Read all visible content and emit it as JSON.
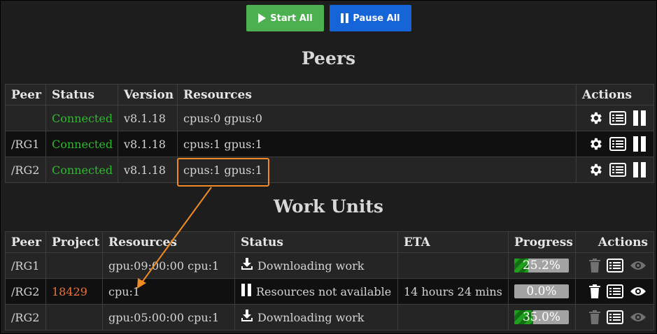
{
  "toolbar": {
    "start_all_label": "Start All",
    "pause_all_label": "Pause All"
  },
  "peers": {
    "title": "Peers",
    "headers": [
      "Peer",
      "Status",
      "Version",
      "Resources",
      "Actions"
    ],
    "rows": [
      {
        "peer": "",
        "status": "Connected",
        "version": "v8.1.18",
        "resources": "cpus:0 gpus:0"
      },
      {
        "peer": "/RG1",
        "status": "Connected",
        "version": "v8.1.18",
        "resources": "cpus:1 gpus:1"
      },
      {
        "peer": "/RG2",
        "status": "Connected",
        "version": "v8.1.18",
        "resources": "cpus:1 gpus:1"
      }
    ]
  },
  "work_units": {
    "title": "Work Units",
    "headers": [
      "Peer",
      "Project",
      "Resources",
      "Status",
      "ETA",
      "Progress",
      "Actions"
    ],
    "rows": [
      {
        "peer": "/RG1",
        "project": "",
        "resources": "gpu:09:00:00 cpu:1",
        "status": "Downloading work",
        "status_icon": "download-icon",
        "eta": "",
        "progress": "25.2%",
        "progress_value": 25.2
      },
      {
        "peer": "/RG2",
        "project": "18429",
        "resources": "cpu:1",
        "status": "Resources not available",
        "status_icon": "pause-icon",
        "eta": "14 hours 24 mins",
        "progress": "0.0%",
        "progress_value": 0.0
      },
      {
        "peer": "/RG2",
        "project": "",
        "resources": "gpu:05:00:00 cpu:1",
        "status": "Downloading work",
        "status_icon": "download-icon",
        "eta": "",
        "progress": "35.0%",
        "progress_value": 35.0
      }
    ]
  },
  "colors": {
    "start_button": "#4caf50",
    "pause_button": "#1565d8",
    "connected": "#2eb82e",
    "project_link": "#e8743b",
    "annotation": "#f08a24"
  }
}
